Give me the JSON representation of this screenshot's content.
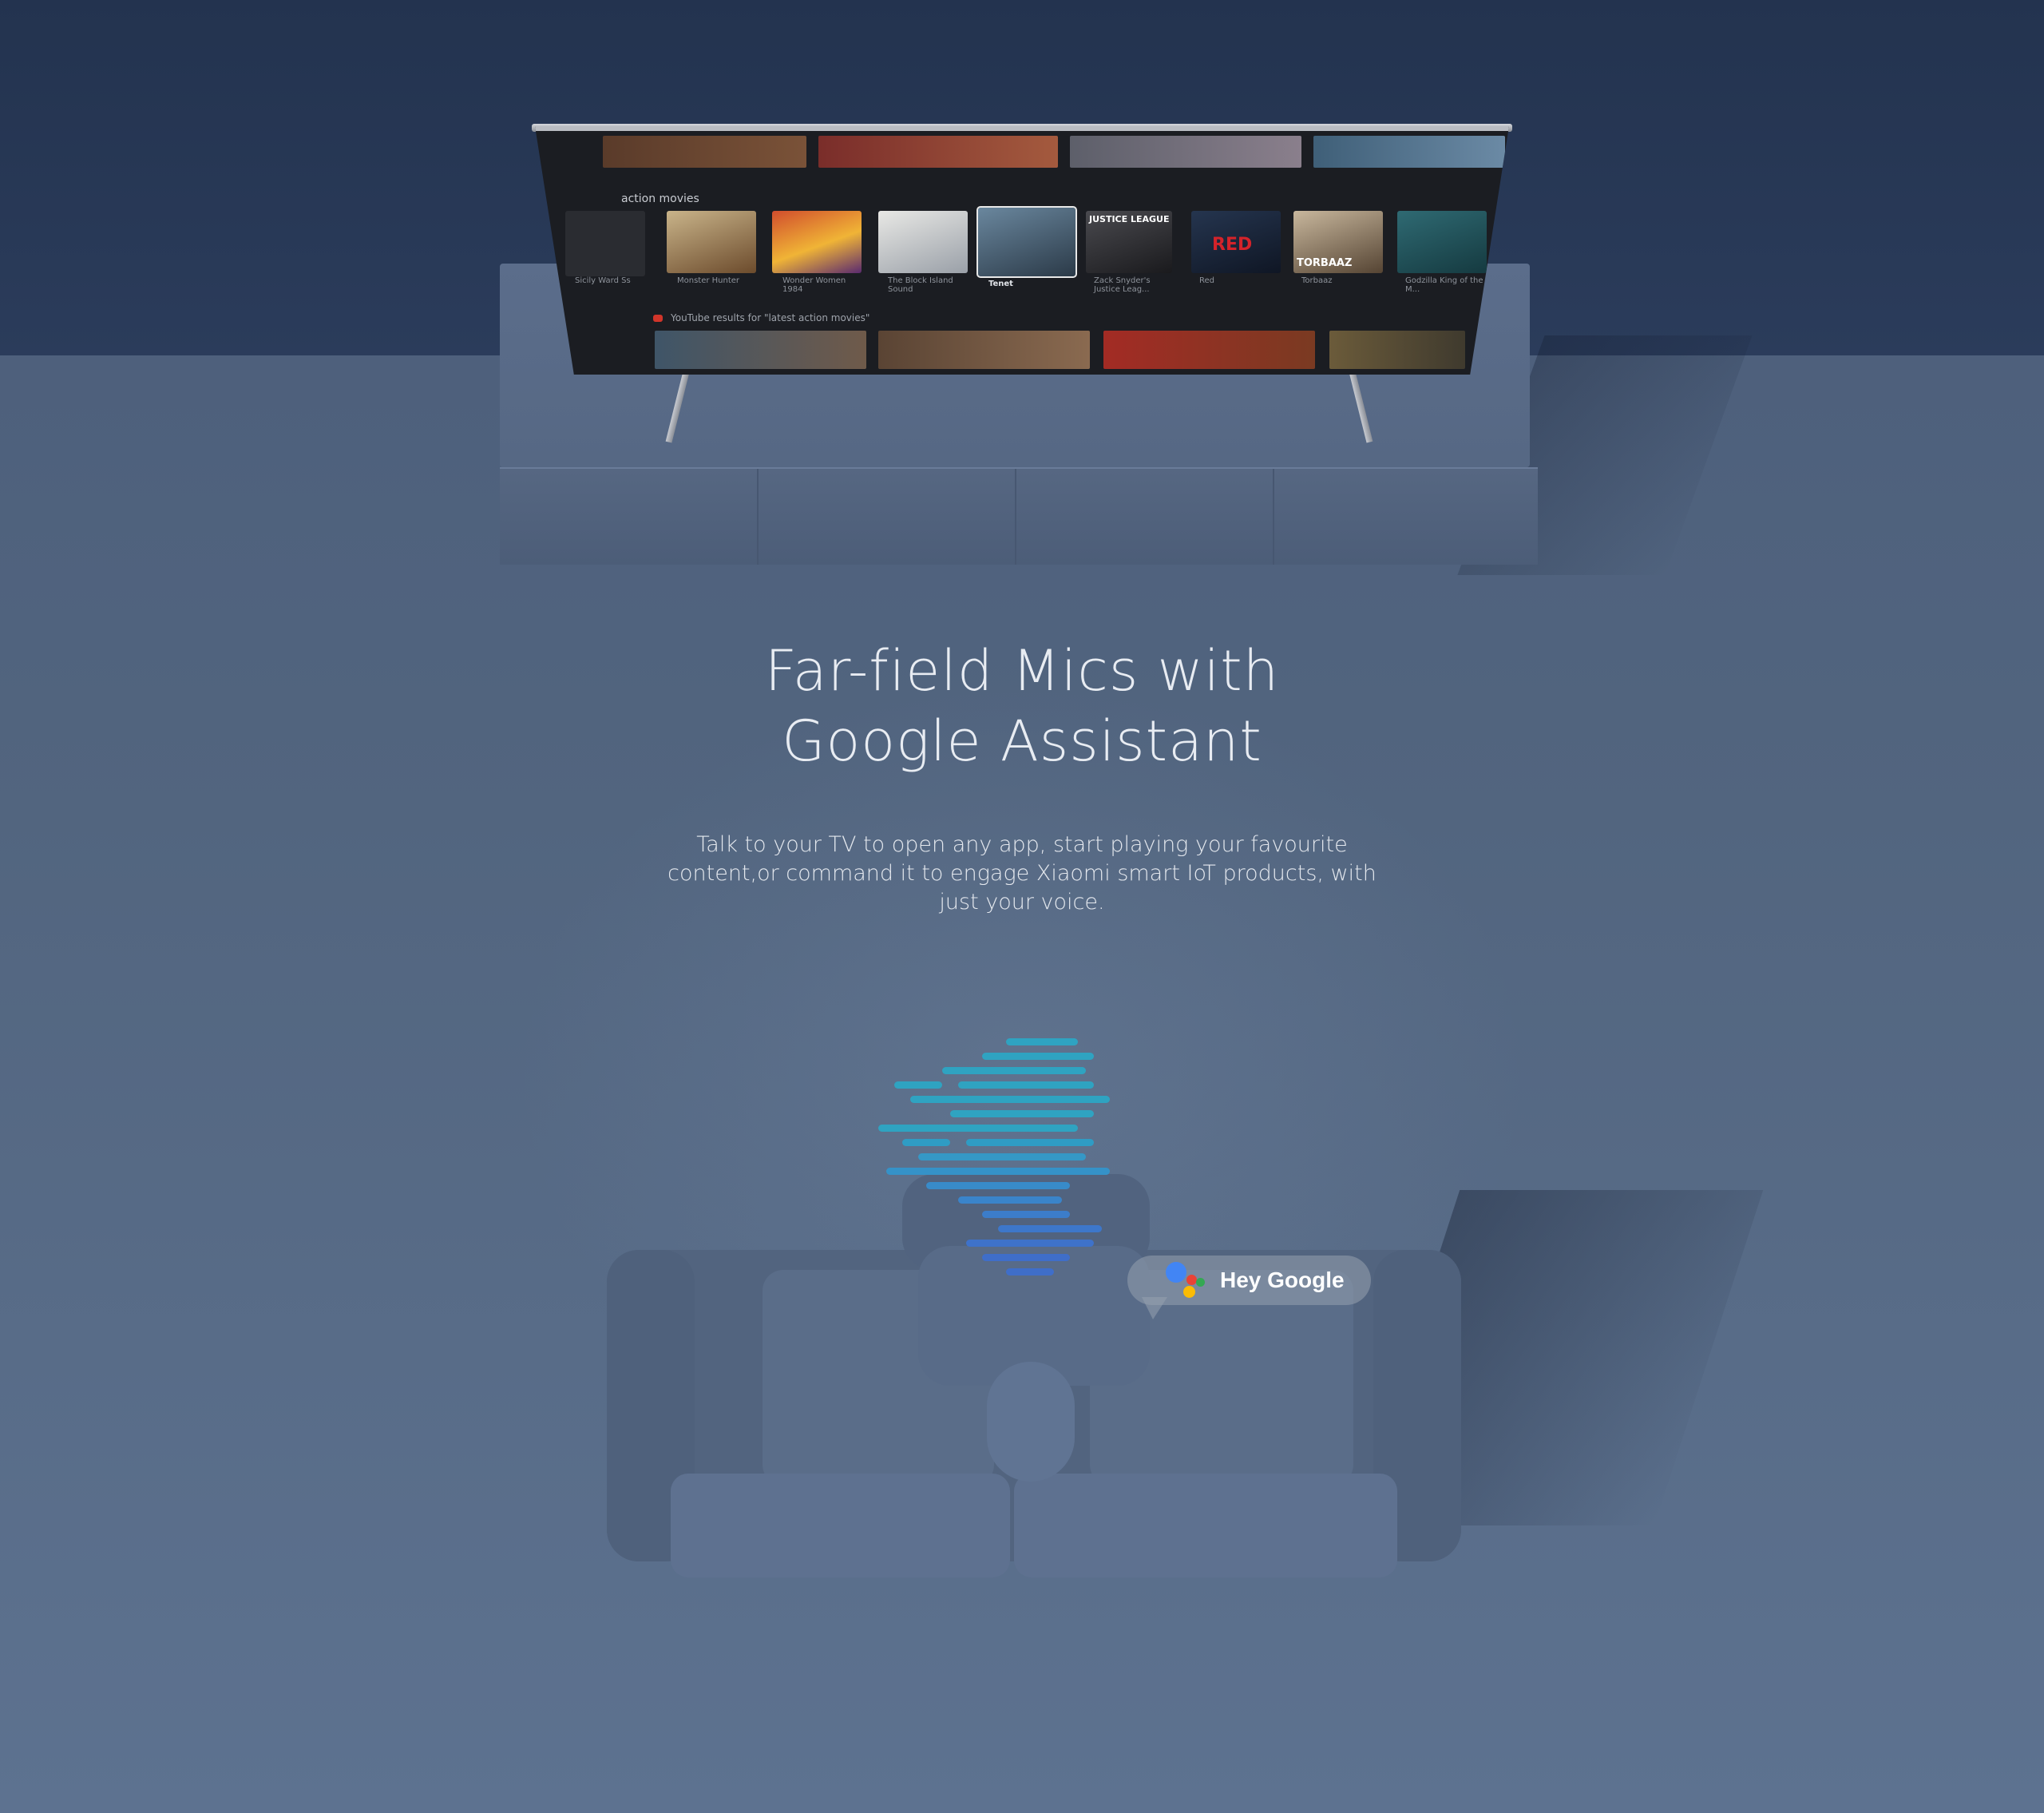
{
  "headline": {
    "line1": "Far-field Mics with",
    "line2": "Google Assistant"
  },
  "body_copy": "Talk to your TV to open any app, start playing your favourite content,or command it to engage Xiaomi smart IoT products, with just your voice.",
  "tv_screen": {
    "row_title": "action movies",
    "posters": [
      {
        "caption": "Sicily Ward Ss"
      },
      {
        "caption": "Monster Hunter"
      },
      {
        "caption": "Wonder Women 1984"
      },
      {
        "caption": "The Block Island Sound"
      },
      {
        "caption": "Tenet"
      },
      {
        "caption": "Zack Snyder's Justice Leag..."
      },
      {
        "caption": "Red"
      },
      {
        "caption": "Torbaaz"
      },
      {
        "caption": "Godzilla King of the M..."
      }
    ],
    "search_result_label": "YouTube results for \"latest action movies\"",
    "poster_tags": {
      "justice_league": "JUSTICE LEAGUE",
      "red": "RED",
      "torbaaz": "TORBAAZ"
    }
  },
  "assistant_bubble": {
    "label": "Hey Google",
    "icon": "google-assistant-icon",
    "dot_colors": [
      "#4285F4",
      "#EA4335",
      "#FBBC05",
      "#34A853"
    ]
  },
  "colors": {
    "wall": "#23334f",
    "floor": "#52657f",
    "wave_teal": "#2fa3c1",
    "wave_blue": "#3f6ec9"
  }
}
